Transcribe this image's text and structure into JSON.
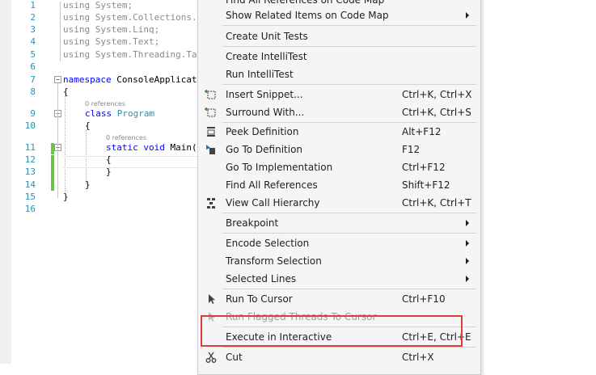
{
  "editor": {
    "line_numbers": [
      "1",
      "2",
      "3",
      "4",
      "5",
      "6",
      "7",
      "8",
      "9",
      "10",
      "11",
      "12",
      "13",
      "14",
      "15",
      "16"
    ],
    "code": {
      "l1_kw": "using",
      "l1_rest": " System;",
      "l2_kw": "using",
      "l2_rest": " System.Collections.G",
      "l3_kw": "using",
      "l3_rest": " System.Linq;",
      "l4_kw": "using",
      "l4_rest": " System.Text;",
      "l5_kw": "using",
      "l5_rest": " System.Threading.Tas",
      "l7_kw": "namespace",
      "l7_rest": " ConsoleApplicati",
      "l8": "{",
      "refs1": "0 references",
      "l9_kw": "class",
      "l9_type": "Program",
      "l10": "{",
      "refs2": "0 references",
      "l11_kw1": "static",
      "l11_kw2": "void",
      "l11_rest": " Main(s",
      "l12": "{",
      "l13": "}",
      "l14": "}",
      "l15": "}"
    }
  },
  "menu": {
    "items": [
      {
        "label": "Find All References on Code Map",
        "shortcut": ""
      },
      {
        "label": "Show Related Items on Code Map",
        "shortcut": ""
      },
      {
        "label": "Create Unit Tests",
        "shortcut": ""
      },
      {
        "label": "Create IntelliTest",
        "shortcut": ""
      },
      {
        "label": "Run IntelliTest",
        "shortcut": ""
      },
      {
        "label": "Insert Snippet...",
        "shortcut": "Ctrl+K, Ctrl+X"
      },
      {
        "label": "Surround With...",
        "shortcut": "Ctrl+K, Ctrl+S"
      },
      {
        "label": "Peek Definition",
        "shortcut": "Alt+F12"
      },
      {
        "label": "Go To Definition",
        "shortcut": "F12"
      },
      {
        "label": "Go To Implementation",
        "shortcut": "Ctrl+F12"
      },
      {
        "label": "Find All References",
        "shortcut": "Shift+F12"
      },
      {
        "label": "View Call Hierarchy",
        "shortcut": "Ctrl+K, Ctrl+T"
      },
      {
        "label": "Breakpoint",
        "shortcut": ""
      },
      {
        "label": "Encode Selection",
        "shortcut": ""
      },
      {
        "label": "Transform Selection",
        "shortcut": ""
      },
      {
        "label": "Selected Lines",
        "shortcut": ""
      },
      {
        "label": "Run To Cursor",
        "shortcut": "Ctrl+F10"
      },
      {
        "label": "Run Flagged Threads To Cursor",
        "shortcut": ""
      },
      {
        "label": "Execute in Interactive",
        "shortcut": "Ctrl+E, Ctrl+E"
      },
      {
        "label": "Cut",
        "shortcut": "Ctrl+X"
      }
    ]
  },
  "colors": {
    "highlight_border": "#d9403b",
    "keyword": "#0000ff",
    "type": "#2b91af",
    "line_number": "#2b91af",
    "change_bar": "#6cc24a"
  }
}
